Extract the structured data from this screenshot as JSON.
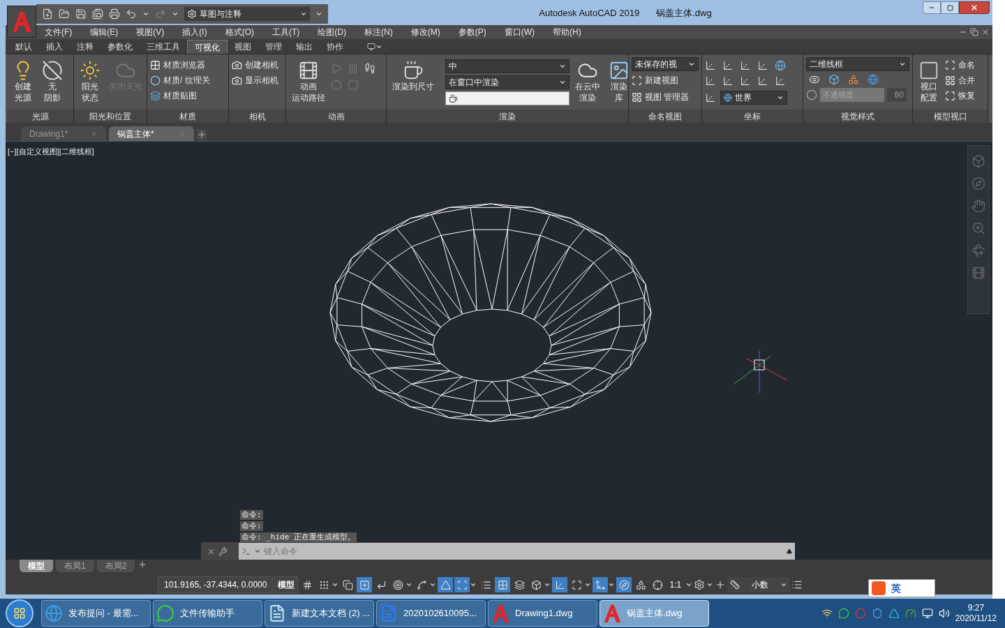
{
  "title_bar": {
    "workspace": "草图与注释",
    "app_title": "Autodesk AutoCAD 2019",
    "file_name": "锅盖主体.dwg"
  },
  "menu": [
    "文件(F)",
    "编辑(E)",
    "视图(V)",
    "插入(I)",
    "格式(O)",
    "工具(T)",
    "绘图(D)",
    "标注(N)",
    "修改(M)",
    "参数(P)",
    "窗口(W)",
    "帮助(H)"
  ],
  "ribbon_tabs": [
    {
      "label": "默认",
      "selected": false
    },
    {
      "label": "插入",
      "selected": false
    },
    {
      "label": "注释",
      "selected": false
    },
    {
      "label": "参数化",
      "selected": false
    },
    {
      "label": "三维工具",
      "selected": false
    },
    {
      "label": "可视化",
      "selected": true
    },
    {
      "label": "视图",
      "selected": false
    },
    {
      "label": "管理",
      "selected": false
    },
    {
      "label": "输出",
      "selected": false
    },
    {
      "label": "协作",
      "selected": false
    }
  ],
  "ribbon": {
    "lights": {
      "title": "光源",
      "buttons": [
        [
          "创建",
          "光源"
        ],
        [
          "无",
          "阴影"
        ]
      ]
    },
    "sun": {
      "title": "阳光和位置",
      "buttons": [
        {
          "label": [
            "阳光",
            "状态"
          ],
          "disabled": false
        },
        {
          "label": [
            "关闭天光"
          ],
          "disabled": true
        }
      ]
    },
    "materials": {
      "title": "材质",
      "items": [
        "材质浏览器",
        "材质/ 纹理关",
        "材质贴图"
      ]
    },
    "camera": {
      "title": "相机",
      "items": [
        "创建相机",
        "显示相机"
      ]
    },
    "animation": {
      "title": "动画",
      "button": [
        "动画",
        "运动路径"
      ]
    },
    "render": {
      "title": "渲染",
      "render_button": [
        "渲染到尺寸"
      ],
      "quality": "中",
      "target": "在窗口中渲染",
      "cloud_button": [
        "在云中",
        "渲染"
      ],
      "gallery_button": [
        "渲染",
        "库"
      ]
    },
    "named_views": {
      "title": "命名视图",
      "view": "未保存的视",
      "items": [
        "新建视图",
        "视图 管理器"
      ]
    },
    "coordinates": {
      "title": "坐标",
      "ucs": "世界"
    },
    "visual_styles": {
      "title": "视觉样式",
      "style": "二维线框",
      "opacity_placeholder": "不透明度",
      "opacity_value": "60"
    },
    "model_viewports": {
      "title": "模型视口",
      "config_button": [
        "视口",
        "配置"
      ],
      "items": [
        "命名",
        "合并",
        "恢复"
      ]
    }
  },
  "file_tabs": [
    {
      "label": "Drawing1*",
      "selected": false
    },
    {
      "label": "锅盖主体*",
      "selected": true
    }
  ],
  "viewport": {
    "label": "[−][自定义视图][二维线框]"
  },
  "command": {
    "history": [
      "命令:",
      "命令:",
      "命令: _hide 正在重生成模型。"
    ],
    "placeholder": "键入命令"
  },
  "layout_tabs": [
    {
      "label": "模型",
      "selected": true
    },
    {
      "label": "布局1",
      "selected": false
    },
    {
      "label": "布局2",
      "selected": false
    }
  ],
  "status_bar": {
    "coordinates": "101.9165, -37.4344, 0.0000",
    "space": "模型",
    "toggles": [
      {
        "kind": "grid",
        "on": false
      },
      {
        "kind": "snap",
        "on": false
      },
      {
        "kind": "infer",
        "on": false
      },
      {
        "kind": "dyn_input",
        "on": true
      },
      {
        "kind": "ortho",
        "on": false
      },
      {
        "kind": "polar",
        "on": false
      },
      {
        "kind": "isodraft",
        "on": false
      },
      {
        "kind": "track",
        "on": true
      },
      {
        "kind": "osnap",
        "on": true
      },
      {
        "kind": "lineweight",
        "on": false
      },
      {
        "kind": "transparency",
        "on": true
      },
      {
        "kind": "cycling",
        "on": false
      },
      {
        "kind": "osnap3d",
        "on": false
      },
      {
        "kind": "ducs",
        "on": true
      },
      {
        "kind": "filter",
        "on": false
      },
      {
        "kind": "gizmo",
        "on": true
      },
      {
        "kind": "annovis",
        "on": true
      },
      {
        "kind": "autoscale",
        "on": false
      },
      {
        "kind": "annoscale",
        "on": false
      }
    ],
    "scale": "1:1",
    "units": "小数"
  },
  "taskbar": {
    "items": [
      {
        "label": "发布提问 - 最需...",
        "kind": "browser",
        "selected": false
      },
      {
        "label": "文件传输助手",
        "kind": "chat",
        "selected": false
      },
      {
        "label": "新建文本文档 (2) ...",
        "kind": "notepad",
        "selected": false
      },
      {
        "label": "2020102610095...",
        "kind": "doc",
        "selected": false
      },
      {
        "label": "Drawing1.dwg",
        "kind": "cad",
        "selected": false
      },
      {
        "label": "锅盖主体.dwg",
        "kind": "cad",
        "selected": true
      }
    ],
    "ime": "英",
    "time": "9:27",
    "date": "2020/11/12"
  }
}
